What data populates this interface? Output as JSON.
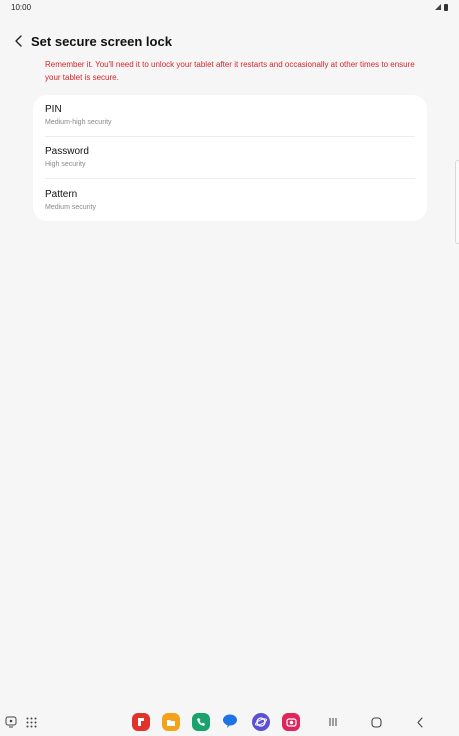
{
  "status_bar": {
    "time": "10:00"
  },
  "header": {
    "title": "Set secure screen lock"
  },
  "warning": "Remember it. You'll need it to unlock your tablet after it restarts and occasionally at other times to ensure your tablet is secure.",
  "options": [
    {
      "title": "PIN",
      "subtitle": "Medium-high security"
    },
    {
      "title": "Password",
      "subtitle": "High security"
    },
    {
      "title": "Pattern",
      "subtitle": "Medium security"
    }
  ],
  "colors": {
    "accent_warning": "#d4252b",
    "background": "#f6f6f6",
    "card": "#ffffff"
  },
  "taskbar": {
    "apps": [
      "flipboard-icon",
      "files-icon",
      "phone-icon",
      "messages-icon",
      "internet-icon",
      "camera-icon"
    ],
    "nav": [
      "recents-icon",
      "home-icon",
      "back-icon"
    ]
  }
}
